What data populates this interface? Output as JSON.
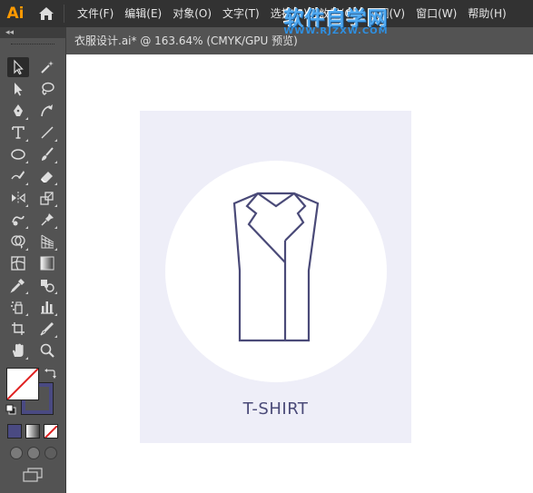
{
  "app": {
    "logo": "Ai",
    "brand_color": "#ff9a00"
  },
  "menu": [
    {
      "label": "文件(F)"
    },
    {
      "label": "编辑(E)"
    },
    {
      "label": "对象(O)"
    },
    {
      "label": "文字(T)"
    },
    {
      "label": "选择(S)"
    },
    {
      "label": "效果(C)"
    },
    {
      "label": "视图(V)"
    },
    {
      "label": "窗口(W)"
    },
    {
      "label": "帮助(H)"
    }
  ],
  "watermark": {
    "title": "软件自学网",
    "url": "WWW.RJZXW.COM"
  },
  "document": {
    "tab_title": "衣服设计.ai* @ 163.64% (CMYK/GPU 预览)"
  },
  "artwork": {
    "label": "T-SHIRT",
    "background_color": "#eeeef8",
    "circle_color": "#ffffff",
    "stroke_color": "#4a4a78"
  },
  "toolbar": {
    "collapse_icon": "double-chevron-left-icon",
    "tools": [
      {
        "name": "selection-tool",
        "icon": "arrow-icon"
      },
      {
        "name": "magic-wand-tool",
        "icon": "magic-wand-icon"
      },
      {
        "name": "direct-selection-tool",
        "icon": "direct-arrow-icon"
      },
      {
        "name": "lasso-tool",
        "icon": "lasso-icon"
      },
      {
        "name": "pen-tool",
        "icon": "pen-icon"
      },
      {
        "name": "curvature-tool",
        "icon": "curvature-icon"
      },
      {
        "name": "type-tool",
        "icon": "type-icon"
      },
      {
        "name": "line-tool",
        "icon": "line-icon"
      },
      {
        "name": "ellipse-tool",
        "icon": "ellipse-icon"
      },
      {
        "name": "paintbrush-tool",
        "icon": "brush-icon"
      },
      {
        "name": "shaper-tool",
        "icon": "shaper-icon"
      },
      {
        "name": "eraser-tool",
        "icon": "eraser-icon"
      },
      {
        "name": "reflect-tool",
        "icon": "reflect-icon"
      },
      {
        "name": "scale-tool",
        "icon": "scale-icon"
      },
      {
        "name": "warp-tool",
        "icon": "warp-icon"
      },
      {
        "name": "puppet-warp-tool",
        "icon": "pin-icon"
      },
      {
        "name": "shape-builder-tool",
        "icon": "shape-builder-icon"
      },
      {
        "name": "perspective-grid-tool",
        "icon": "perspective-icon"
      },
      {
        "name": "mesh-tool",
        "icon": "mesh-icon"
      },
      {
        "name": "gradient-tool",
        "icon": "gradient-icon"
      },
      {
        "name": "eyedropper-tool",
        "icon": "eyedropper-icon"
      },
      {
        "name": "blend-tool",
        "icon": "blend-icon"
      },
      {
        "name": "symbol-sprayer-tool",
        "icon": "symbol-sprayer-icon"
      },
      {
        "name": "graph-tool",
        "icon": "bar-graph-icon"
      },
      {
        "name": "artboard-tool",
        "icon": "artboard-icon"
      },
      {
        "name": "slice-tool",
        "icon": "knife-icon"
      },
      {
        "name": "hand-tool",
        "icon": "hand-icon"
      },
      {
        "name": "zoom-tool",
        "icon": "magnifier-icon"
      }
    ],
    "fill_color": "#ffffff",
    "stroke_color": "#4a4a82",
    "none_color": "#e02020",
    "color_modes": [
      {
        "name": "color-mode",
        "color": "#4a4a82"
      },
      {
        "name": "gradient-mode",
        "color": "#aaaaaa"
      },
      {
        "name": "none-mode",
        "color": "#e02020"
      }
    ]
  }
}
